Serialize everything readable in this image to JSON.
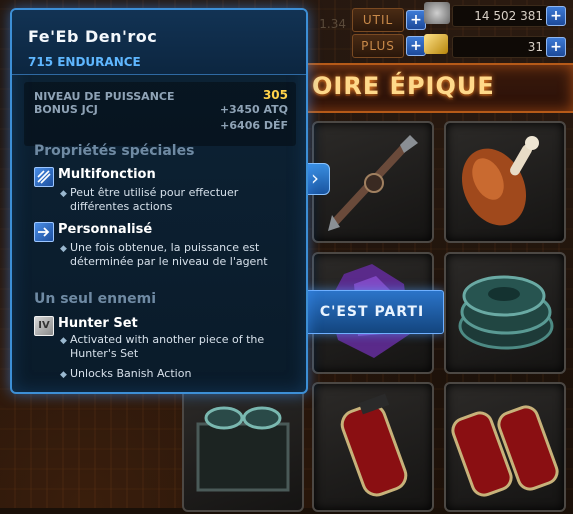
{
  "topbar": {
    "util_label": "UTIL",
    "plus_label": "PLUS",
    "currency_value": "14 502 381",
    "gold_value": "31",
    "partial_value": "1.34",
    "add_symbol": "+"
  },
  "screen_title": "OIRE ÉPIQUE",
  "action_button": "C'EST PARTI",
  "tooltip": {
    "name": "Fe'Eb Den'roc",
    "subtitle": "715 ENDURANCE",
    "power_label": "NIVEAU DE PUISSANCE",
    "power_value": "305",
    "pvp_label": "BONUS JCJ",
    "atk_bonus": "+3450 ATQ",
    "def_bonus": "+6406 DÉF",
    "special_heading": "Propriétés spéciales",
    "props": [
      {
        "title": "Multifonction",
        "desc": "Peut être utilisé pour effectuer différentes actions",
        "icon": "multifunction-icon"
      },
      {
        "title": "Personnalisé",
        "desc": "Une fois obtenue, la puissance est déterminée par le niveau de l'agent",
        "icon": "personalized-icon"
      }
    ],
    "enemy_heading": "Un seul ennemi",
    "set": {
      "title": "Hunter Set",
      "icon": "set-iv-icon",
      "icon_text": "IV",
      "bullets": [
        "Activated with another piece of the Hunter's Set",
        "Unlocks Banish Action"
      ]
    }
  },
  "colors": {
    "tooltip_border": "#3d8fd6",
    "subtitle_blue": "#5fb7ff",
    "power_gold": "#ffd24a",
    "title_orange": "#ffd98a"
  }
}
